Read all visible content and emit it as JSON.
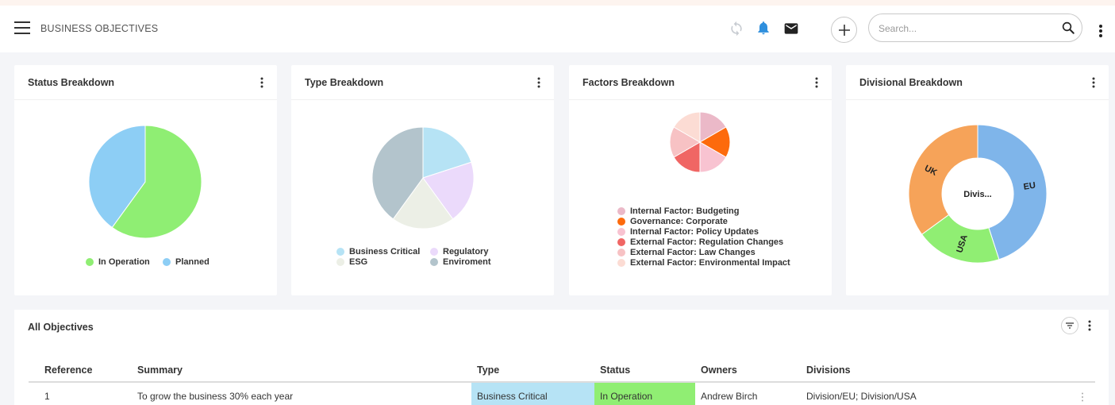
{
  "header": {
    "title": "BUSINESS OBJECTIVES",
    "search_placeholder": "Search...",
    "icons": [
      "menu-icon",
      "sync-icon",
      "bell-icon",
      "mail-icon",
      "plus-icon",
      "search-icon",
      "more-vert-icon"
    ],
    "colors": {
      "bell": "#2f8fdd",
      "sync": "#c8ccd2"
    }
  },
  "cards": [
    {
      "title": "Status Breakdown"
    },
    {
      "title": "Type Breakdown"
    },
    {
      "title": "Factors Breakdown"
    },
    {
      "title": "Divisional Breakdown"
    }
  ],
  "chart_data": [
    {
      "type": "pie",
      "title": "Status Breakdown",
      "slices": [
        {
          "label": "In Operation",
          "value": 60,
          "color": "#8fee73"
        },
        {
          "label": "Planned",
          "value": 40,
          "color": "#8dcef5"
        }
      ],
      "legend": "bottom"
    },
    {
      "type": "pie",
      "title": "Type Breakdown",
      "slices": [
        {
          "label": "Business Critical",
          "value": 20,
          "color": "#b6e3f5"
        },
        {
          "label": "Regulatory",
          "value": 20,
          "color": "#ebdafb"
        },
        {
          "label": "ESG",
          "value": 20,
          "color": "#ecefe6"
        },
        {
          "label": "Enviroment",
          "value": 40,
          "color": "#b3c4cc"
        }
      ],
      "legend": "bottom"
    },
    {
      "type": "pie",
      "title": "Factors Breakdown",
      "slices": [
        {
          "label": "Internal Factor: Budgeting",
          "value": 16.67,
          "color": "#ebb9c8"
        },
        {
          "label": "Governance: Corporate",
          "value": 16.67,
          "color": "#fd6a0c"
        },
        {
          "label": "Internal Factor: Policy Updates",
          "value": 16.67,
          "color": "#f8c3d1"
        },
        {
          "label": "External Factor: Regulation Changes",
          "value": 16.67,
          "color": "#f06664"
        },
        {
          "label": "External Factor: Law Changes",
          "value": 16.67,
          "color": "#f7c2c4"
        },
        {
          "label": "External Factor: Environmental Impact",
          "value": 16.67,
          "color": "#fcdcd4"
        }
      ],
      "legend": "bottom"
    },
    {
      "type": "pie",
      "title": "Divisional Breakdown",
      "donut": true,
      "center_label": "Divis...",
      "slices": [
        {
          "label": "EU",
          "value": 45,
          "color": "#7fb5ea"
        },
        {
          "label": "USA",
          "value": 20,
          "color": "#90ee73"
        },
        {
          "label": "UK",
          "value": 35,
          "color": "#f6a359"
        }
      ]
    }
  ],
  "table": {
    "title": "All Objectives",
    "columns": [
      "Reference",
      "Summary",
      "Type",
      "Status",
      "Owners",
      "Divisions"
    ],
    "rows": [
      {
        "reference": "1",
        "summary": "To grow the business 30% each year",
        "type": "Business Critical",
        "status": "In Operation",
        "owners": "Andrew Birch",
        "divisions": "Division/EU; Division/USA",
        "type_color": "#b6e3f5",
        "status_color": "#90ee73"
      }
    ]
  }
}
